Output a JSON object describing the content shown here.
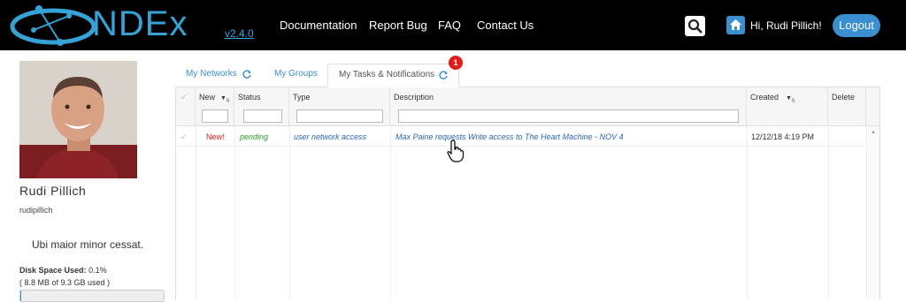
{
  "app": {
    "logo_text": "NDEx",
    "version": "v2.4.0"
  },
  "nav": {
    "items": [
      "Documentation",
      "Report Bug",
      "FAQ",
      "Contact Us"
    ],
    "greeting": "Hi, Rudi Pillich!",
    "logout": "Logout"
  },
  "profile": {
    "name": "Rudi Pillich",
    "username": "rudipillich",
    "motto": "Ubi maior minor cessat.",
    "disk_label": "Disk Space Used:",
    "disk_percent": "0.1%",
    "disk_detail": "( 8.8 MB of 9.3 GB used )",
    "disk_fraction": 0.001
  },
  "tabs": [
    {
      "label": "My Networks"
    },
    {
      "label": "My Groups"
    },
    {
      "label": "My Tasks & Notifications"
    }
  ],
  "notification_count": "1",
  "table": {
    "headers": [
      "New",
      "Status",
      "Type",
      "Description",
      "Created",
      "Delete"
    ],
    "rows": [
      {
        "new": "New!",
        "status": "pending",
        "type": "user network access",
        "description": "Max Paine requests Write access to The Heart Machine - NOV 4",
        "created": "12/12/18 4:19 PM"
      }
    ]
  },
  "colors": {
    "accent": "#3a8fd0",
    "logo": "#35a3d6",
    "badge": "#e01b1b",
    "status_pending": "#2f9a2f"
  }
}
